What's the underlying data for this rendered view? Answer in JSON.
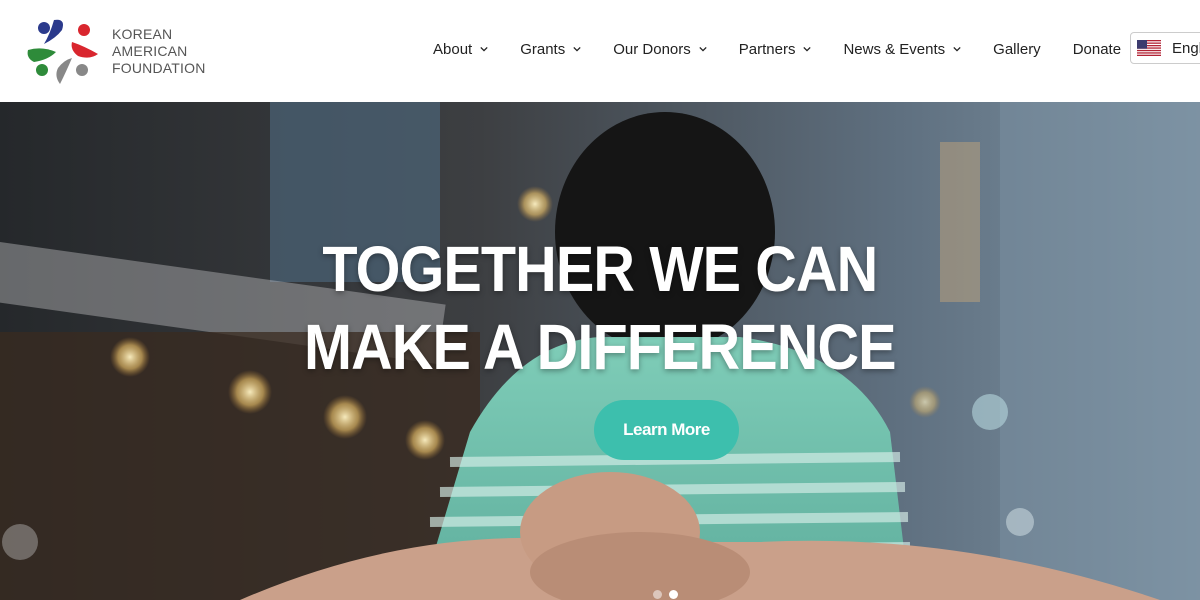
{
  "logo": {
    "lines": [
      "KOREAN",
      "AMERICAN",
      "FOUNDATION"
    ],
    "colors": [
      "#2b3a8c",
      "#d9262e",
      "#2e8b3a",
      "#777777"
    ]
  },
  "nav": {
    "items": [
      {
        "label": "About",
        "has_dropdown": true
      },
      {
        "label": "Grants",
        "has_dropdown": true
      },
      {
        "label": "Our Donors",
        "has_dropdown": true
      },
      {
        "label": "Partners",
        "has_dropdown": true
      },
      {
        "label": "News & Events",
        "has_dropdown": true
      },
      {
        "label": "Gallery",
        "has_dropdown": false
      },
      {
        "label": "Donate",
        "has_dropdown": false
      }
    ]
  },
  "language": {
    "label": "Engl",
    "flag": "us-flag-icon"
  },
  "hero": {
    "title_line1": "TOGETHER WE CAN",
    "title_line2": "MAKE A DIFFERENCE",
    "button_label": "Learn More",
    "button_color": "#3dbfad",
    "slides_count": 2,
    "active_slide": 2
  }
}
